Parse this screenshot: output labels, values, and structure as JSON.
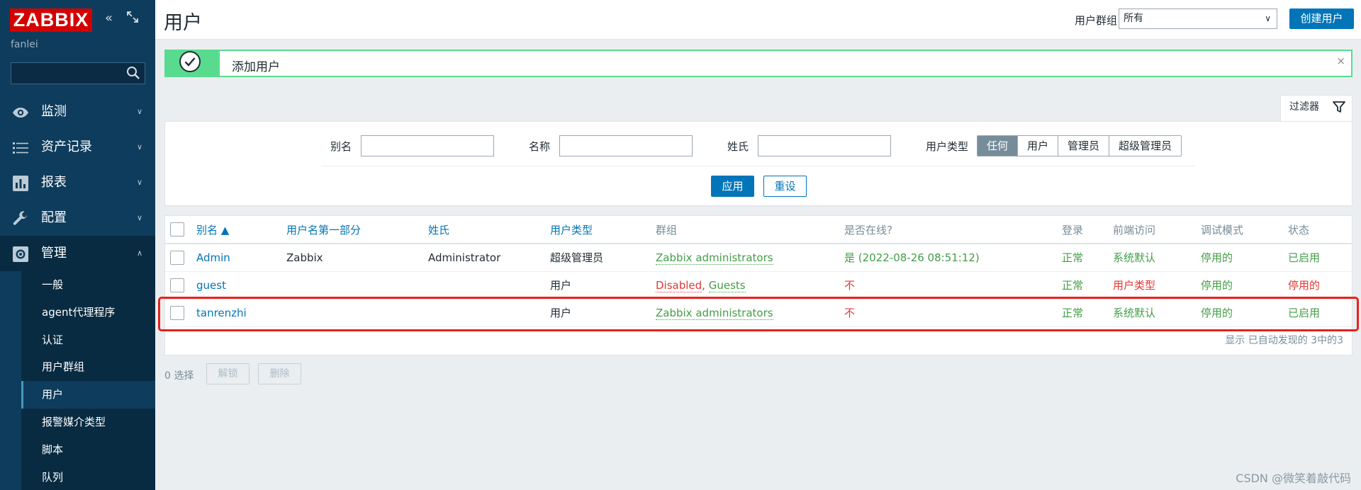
{
  "sidebar": {
    "logo": "ZABBIX",
    "server_name": "fanlei",
    "search_value": "",
    "menu": [
      {
        "label": "监测",
        "icon": "eye-icon"
      },
      {
        "label": "资产记录",
        "icon": "list-icon"
      },
      {
        "label": "报表",
        "icon": "bar-chart-icon"
      },
      {
        "label": "配置",
        "icon": "wrench-icon"
      },
      {
        "label": "管理",
        "icon": "gear-icon",
        "expanded": true
      }
    ],
    "submenu": [
      "一般",
      "agent代理程序",
      "认证",
      "用户群组",
      "用户",
      "报警媒介类型",
      "脚本",
      "队列"
    ],
    "submenu_selected": "用户"
  },
  "header": {
    "title": "用户",
    "usergroup_label": "用户群组",
    "usergroup_value": "所有",
    "create_button": "创建用户"
  },
  "message": {
    "text": "添加用户",
    "close": "×"
  },
  "filter": {
    "tab_label": "过滤器",
    "alias_label": "别名",
    "alias_value": "",
    "name_label": "名称",
    "name_value": "",
    "surname_label": "姓氏",
    "surname_value": "",
    "usertype_label": "用户类型",
    "usertype_options": [
      "任何",
      "用户",
      "管理员",
      "超级管理员"
    ],
    "usertype_selected": "任何",
    "apply": "应用",
    "reset": "重设"
  },
  "table": {
    "columns": [
      "别名 ▲",
      "用户名第一部分",
      "姓氏",
      "用户类型",
      "群组",
      "是否在线?",
      "登录",
      "前端访问",
      "调试模式",
      "状态"
    ],
    "rows": [
      {
        "alias": "Admin",
        "name": "Zabbix",
        "surname": "Administrator",
        "type": "超级管理员",
        "groups": "Zabbix administrators",
        "groups_disabled": "",
        "online": "是 (2022-08-26 08:51:12)",
        "login": "正常",
        "frontend": "系统默认",
        "debug": "停用的",
        "status": "已启用"
      },
      {
        "alias": "guest",
        "name": "",
        "surname": "",
        "type": "用户",
        "groups": "Guests",
        "groups_disabled": "Disabled",
        "online": "不",
        "login": "正常",
        "frontend": "用户类型",
        "debug": "停用的",
        "status": "停用的"
      },
      {
        "alias": "tanrenzhi",
        "name": "",
        "surname": "",
        "type": "用户",
        "groups": "Zabbix administrators",
        "groups_disabled": "",
        "online": "不",
        "login": "正常",
        "frontend": "系统默认",
        "debug": "停用的",
        "status": "已启用"
      }
    ],
    "footer": "显示 已自动发现的 3中的3"
  },
  "bulk": {
    "selected": "0 选择",
    "unlock": "解锁",
    "delete": "删除"
  },
  "watermark": "CSDN @微笑着敲代码",
  "colors": {
    "sidebar": "#0e3c5c",
    "primary": "#0275b8",
    "success": "#59db8f",
    "green_text": "#429e47",
    "red_text": "#e33734",
    "highlight": "#e8211d"
  }
}
